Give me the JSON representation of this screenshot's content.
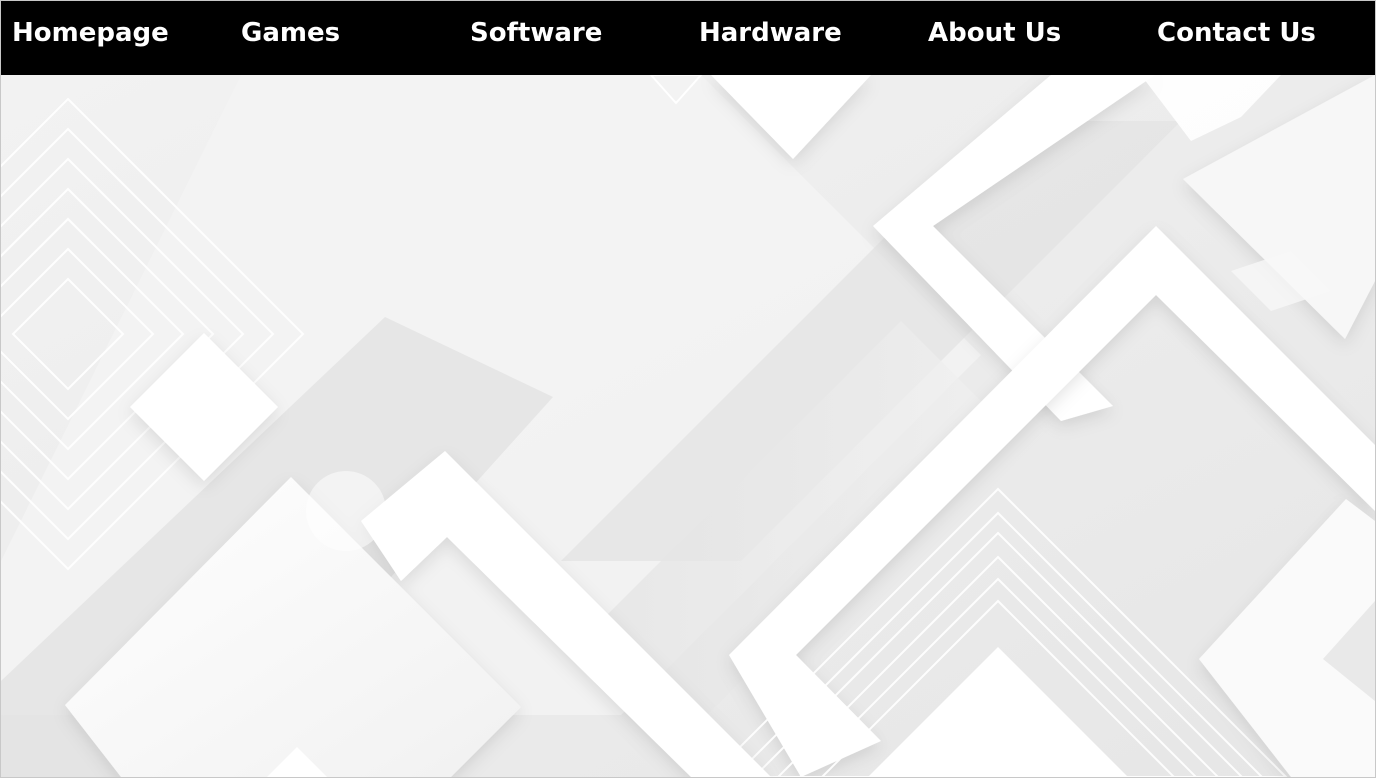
{
  "nav": {
    "items": [
      {
        "label": "Homepage"
      },
      {
        "label": "Games"
      },
      {
        "label": "Software"
      },
      {
        "label": "Hardware"
      },
      {
        "label": "About Us"
      },
      {
        "label": "Contact Us"
      }
    ]
  },
  "colors": {
    "navbar_background": "#000000",
    "nav_text": "#ffffff",
    "hero_background": "#ededed"
  }
}
